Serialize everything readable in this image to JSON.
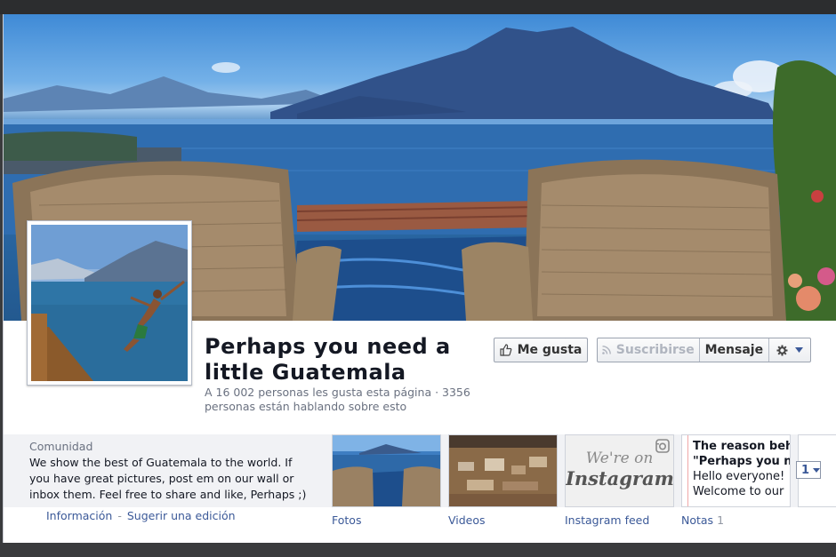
{
  "page": {
    "title": "Perhaps you need a little Guatemala",
    "likes_line": "A 16 002 personas les gusta esta página · 3356 personas están hablando sobre esto"
  },
  "actions": {
    "like_label": "Me gusta",
    "subscribe_label": "Suscribirse",
    "message_label": "Mensaje"
  },
  "about": {
    "category": "Comunidad",
    "description": "We show the best of Guatemala to the world. If you have great pictures, post em on our wall or inbox them. Feel free to share and like, Perhaps ;)",
    "info_link": "Información",
    "separator": "-",
    "suggest_link": "Sugerir una edición"
  },
  "apps": [
    {
      "label": "Fotos"
    },
    {
      "label": "Videos"
    },
    {
      "label": "Instagram feed",
      "tile_text_1": "We're on",
      "tile_text_2": "Instagram"
    },
    {
      "label": "Notas",
      "count": "1",
      "lines": [
        "The reason behin",
        "\"Perhaps you nee",
        "Hello everyone!",
        "Welcome to our"
      ]
    }
  ],
  "more_count": "1",
  "icons": {
    "like": "thumbs-up-icon",
    "subscribe": "rss-icon",
    "settings": "gear-icon",
    "dropdown": "caret-down-icon",
    "instagram": "instagram-camera-icon"
  }
}
